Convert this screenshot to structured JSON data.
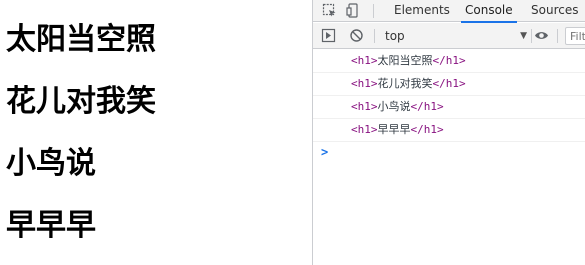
{
  "page": {
    "headings": [
      "太阳当空照",
      "花儿对我笑",
      "小鸟说",
      "早早早"
    ]
  },
  "devtools": {
    "tabs": [
      "Elements",
      "Console",
      "Sources"
    ],
    "active_tab": "Console",
    "toolbar": {
      "context": "top",
      "filter_placeholder": "Filt"
    },
    "console": {
      "logs": [
        {
          "open_tag": "<h1>",
          "text": "太阳当空照",
          "close_tag": "</h1>"
        },
        {
          "open_tag": "<h1>",
          "text": "花儿对我笑",
          "close_tag": "</h1>"
        },
        {
          "open_tag": "<h1>",
          "text": "小鸟说",
          "close_tag": "</h1>"
        },
        {
          "open_tag": "<h1>",
          "text": "早早早",
          "close_tag": "</h1>"
        }
      ],
      "prompt_symbol": ">"
    },
    "colors": {
      "accent": "#1a73e8",
      "tag": "#881280",
      "toolbar_bg": "#f3f3f3",
      "border": "#cbcdd1"
    }
  }
}
